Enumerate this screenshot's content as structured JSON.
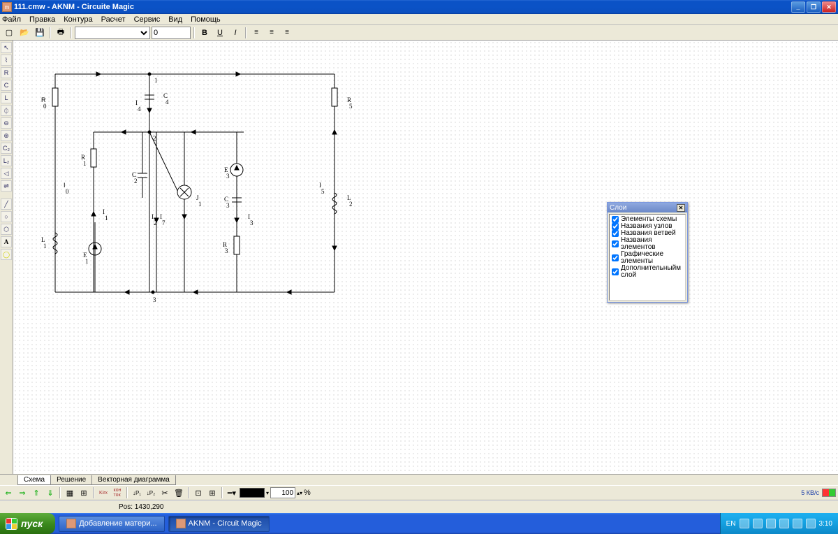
{
  "window": {
    "title": "111.cmw - AKNM - Circuite Magic"
  },
  "menu": [
    "Файл",
    "Правка",
    "Контура",
    "Расчет",
    "Сервис",
    "Вид",
    "Помощь"
  ],
  "toolbar": {
    "font_size": "0"
  },
  "left_tools": [
    "↖",
    "⌇",
    "R",
    "C",
    "L",
    "⏀",
    "⊖",
    "⊕",
    "C₂",
    "L₂",
    "◁",
    "⇌",
    "╱",
    "○",
    "⬡",
    "A",
    "◯"
  ],
  "nodes": {
    "n1": "1",
    "n2": "2",
    "n3": "3"
  },
  "labels": {
    "R0": "R",
    "R0s": "0",
    "I0": "I",
    "I0s": "0",
    "L1": "L",
    "L1s": "1",
    "E1": "E",
    "E1s": "1",
    "I4": "I",
    "I4s": "4",
    "C4": "C",
    "C4s": "4",
    "R1": "R",
    "R1s": "1",
    "I1": "I",
    "I1s": "1",
    "C2": "C",
    "C2s": "2",
    "I7": "I",
    "I7s": "7",
    "I2": "I",
    "I2s": "2",
    "J1": "J",
    "J1s": "1",
    "E3": "E",
    "E3s": "3",
    "C3": "C",
    "C3s": "3",
    "I3": "I",
    "I3s": "3",
    "R3": "R",
    "R3s": "3",
    "I5": "I",
    "I5s": "5",
    "L2": "L",
    "L2s": "2",
    "R5": "R",
    "R5s": "5"
  },
  "layers": {
    "title": "Слои",
    "items": [
      "Элементы схемы",
      "Названия узлов",
      "Названия ветвей",
      "Названия элементов",
      "Графические элементы",
      "Дополнительныйм слой"
    ]
  },
  "doctabs": [
    "Схема",
    "Решение",
    "Векторная диаграмма"
  ],
  "bottom": {
    "zoom": "100",
    "pct": "%"
  },
  "net": "5 КВ/с",
  "status": {
    "pos": "Pos: 1430,290"
  },
  "taskbar": {
    "start": "пуск",
    "task1": "Добавление матери...",
    "task2": "AKNM - Circuit Magic",
    "lang": "EN",
    "clock": "3:10"
  }
}
